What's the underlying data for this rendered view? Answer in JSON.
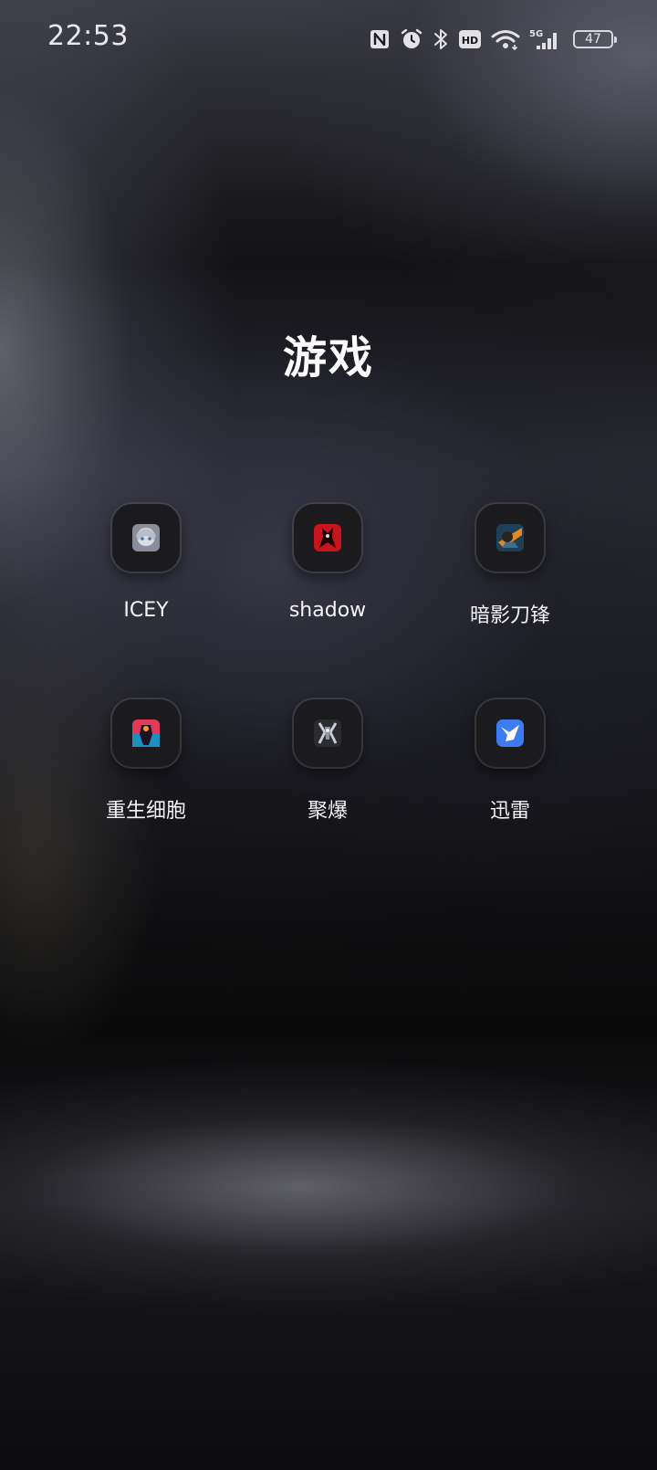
{
  "status_bar": {
    "time": "22:53",
    "icons": [
      "nfc-icon",
      "alarm-icon",
      "bluetooth-icon",
      "hd-icon",
      "wifi-icon",
      "signal-5g-icon",
      "battery-icon"
    ],
    "network_type": "5G",
    "hd_label": "HD",
    "battery_level": "47"
  },
  "folder": {
    "title": "游戏",
    "apps": [
      {
        "label": "ICEY",
        "icon": "icey-app-icon"
      },
      {
        "label": "shadow",
        "icon": "shadow-app-icon"
      },
      {
        "label": "暗影刀锋",
        "icon": "shadow-blade-app-icon"
      },
      {
        "label": "重生细胞",
        "icon": "dead-cells-app-icon"
      },
      {
        "label": "聚爆",
        "icon": "implosion-app-icon"
      },
      {
        "label": "迅雷",
        "icon": "xunlei-app-icon"
      }
    ]
  },
  "colors": {
    "text": "#ffffff",
    "tile_background": "#1b1b1d",
    "xunlei_blue": "#3e7bf0"
  }
}
